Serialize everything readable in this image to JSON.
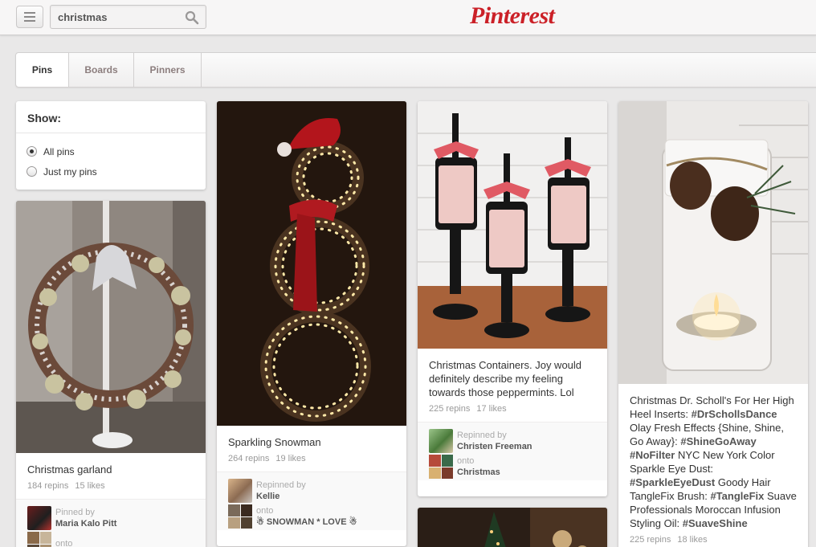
{
  "header": {
    "search_value": "christmas",
    "logo": "Pinterest",
    "menu_icon": "hamburger-icon",
    "search_icon": "search-icon"
  },
  "tabs": [
    {
      "label": "Pins",
      "active": true
    },
    {
      "label": "Boards",
      "active": false
    },
    {
      "label": "Pinners",
      "active": false
    }
  ],
  "filter": {
    "title": "Show:",
    "options": [
      {
        "label": "All pins",
        "selected": true
      },
      {
        "label": "Just my pins",
        "selected": false
      }
    ]
  },
  "pins": [
    {
      "description": "Christmas garland",
      "repins": "184 repins",
      "likes": "15 likes",
      "action": "Pinned by",
      "user": "Maria Kalo Pitt",
      "onto_label": "onto"
    },
    {
      "description": "Sparkling Snowman",
      "repins": "264 repins",
      "likes": "19 likes",
      "action": "Repinned by",
      "user": "Kellie",
      "onto_label": "onto",
      "board": "☃ SNOWMAN * LOVE ☃"
    },
    {
      "description": "Christmas Containers. Joy would definitely describe my feeling towards those peppermints. Lol",
      "repins": "225 repins",
      "likes": "17 likes",
      "action": "Repinned by",
      "user": "Christen Freeman",
      "onto_label": "onto",
      "board": "Christmas"
    },
    {
      "description_parts": [
        {
          "t": "Christmas Dr. Scholl's For Her High Heel Inserts: ",
          "tag": false
        },
        {
          "t": "#DrSchollsDance",
          "tag": true
        },
        {
          "t": " Olay Fresh Effects {Shine, Shine, Go Away}: ",
          "tag": false
        },
        {
          "t": "#ShineGoAway",
          "tag": true
        },
        {
          "t": " ",
          "tag": false
        },
        {
          "t": "#NoFilter",
          "tag": true
        },
        {
          "t": " NYC New York Color Sparkle Eye Dust: ",
          "tag": false
        },
        {
          "t": "#SparkleEyeDust",
          "tag": true
        },
        {
          "t": " Goody Hair TangleFix Brush: ",
          "tag": false
        },
        {
          "t": "#TangleFix",
          "tag": true
        },
        {
          "t": " Suave Professionals Moroccan Infusion Styling Oil: ",
          "tag": false
        },
        {
          "t": "#SuaveShine",
          "tag": true
        }
      ],
      "repins": "225 repins",
      "likes": "18 likes"
    }
  ],
  "colors": {
    "brand": "#cb2027",
    "background": "#e9e8e8"
  }
}
